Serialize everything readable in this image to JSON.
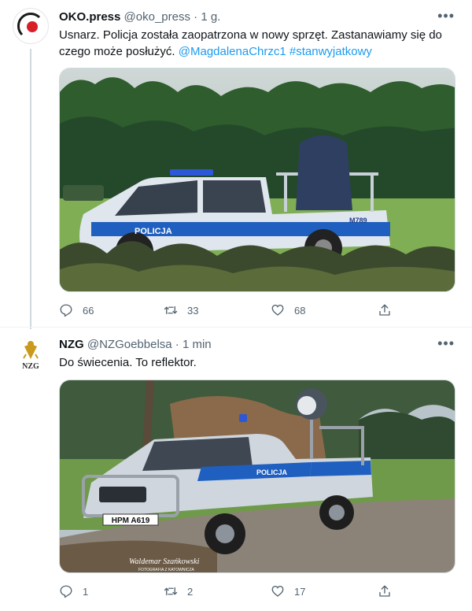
{
  "tweets": [
    {
      "name": "OKO.press",
      "handle": "@oko_press",
      "separator": "·",
      "time": "1 g.",
      "text": "Usnarz. Policja została zaopatrzona w nowy sprzęt. Zastanawiamy się do czego może posłużyć.",
      "mention": "@MagdalenaChrzc1",
      "hashtag": "#stanwyjatkowy",
      "photo": {
        "door_text": "POLICJA",
        "plate_text": "M789"
      },
      "replies": "66",
      "retweets": "33",
      "likes": "68",
      "avatar_icon": "oko-press-logo-icon"
    },
    {
      "name": "NZG",
      "handle": "@NZGoebbelsa",
      "separator": "·",
      "time": "1 min",
      "text": "Do świecenia. To reflektor.",
      "avatar_text": "NZG",
      "photo": {
        "door_text": "POLICJA",
        "plate_text": "HPM A619",
        "watermark": "Waldemar Szańkowski",
        "watermark_sub": "FOTOGRAFIA Z KATOWNICZA"
      },
      "replies": "1",
      "retweets": "2",
      "likes": "17"
    }
  ],
  "colors": {
    "link": "#1d9bf0",
    "muted": "#536471",
    "police_blue": "#1f5fbf"
  },
  "icons": [
    "more-icon",
    "reply-icon",
    "retweet-icon",
    "like-icon",
    "share-icon"
  ]
}
